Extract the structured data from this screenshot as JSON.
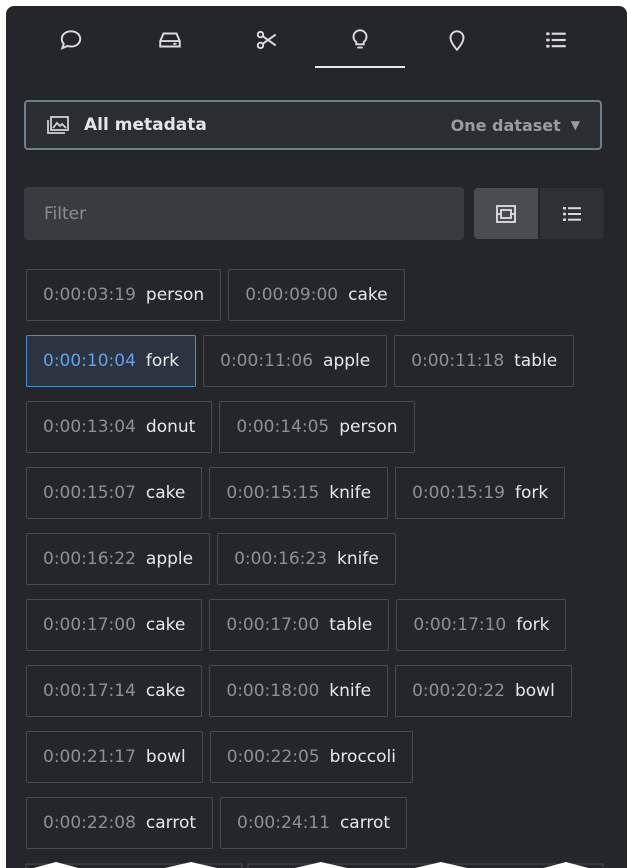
{
  "tabs": [
    {
      "icon": "chat-bubble-icon"
    },
    {
      "icon": "drive-icon"
    },
    {
      "icon": "scissors-icon"
    },
    {
      "icon": "lightbulb-icon",
      "active": true
    },
    {
      "icon": "location-pin-icon"
    },
    {
      "icon": "list-icon"
    }
  ],
  "scope": {
    "label": "All metadata",
    "value": "One dataset",
    "icon": "images-icon"
  },
  "filter": {
    "placeholder": "Filter",
    "value": ""
  },
  "view_toggle": {
    "active": "grid",
    "icons": [
      "grid-view-icon",
      "list-view-icon"
    ]
  },
  "chips": [
    [
      {
        "time": "0:00:03:19",
        "label": "person"
      },
      {
        "time": "0:00:09:00",
        "label": "cake"
      }
    ],
    [
      {
        "time": "0:00:10:04",
        "label": "fork",
        "selected": true
      },
      {
        "time": "0:00:11:06",
        "label": "apple"
      },
      {
        "time": "0:00:11:18",
        "label": "table"
      }
    ],
    [
      {
        "time": "0:00:13:04",
        "label": "donut"
      },
      {
        "time": "0:00:14:05",
        "label": "person"
      }
    ],
    [
      {
        "time": "0:00:15:07",
        "label": "cake"
      },
      {
        "time": "0:00:15:15",
        "label": "knife"
      },
      {
        "time": "0:00:15:19",
        "label": "fork"
      }
    ],
    [
      {
        "time": "0:00:16:22",
        "label": "apple"
      },
      {
        "time": "0:00:16:23",
        "label": "knife"
      }
    ],
    [
      {
        "time": "0:00:17:00",
        "label": "cake"
      },
      {
        "time": "0:00:17:00",
        "label": "table"
      },
      {
        "time": "0:00:17:10",
        "label": "fork"
      }
    ],
    [
      {
        "time": "0:00:17:14",
        "label": "cake"
      },
      {
        "time": "0:00:18:00",
        "label": "knife"
      },
      {
        "time": "0:00:20:22",
        "label": "bowl"
      }
    ],
    [
      {
        "time": "0:00:21:17",
        "label": "bowl"
      },
      {
        "time": "0:00:22:05",
        "label": "broccoli"
      }
    ],
    [
      {
        "time": "0:00:22:08",
        "label": "carrot"
      },
      {
        "time": "0:00:24:11",
        "label": "carrot"
      }
    ]
  ],
  "colors": {
    "panel_bg": "#25262a",
    "accent_blue": "#5fa3e6",
    "border": "#4a4b50"
  }
}
